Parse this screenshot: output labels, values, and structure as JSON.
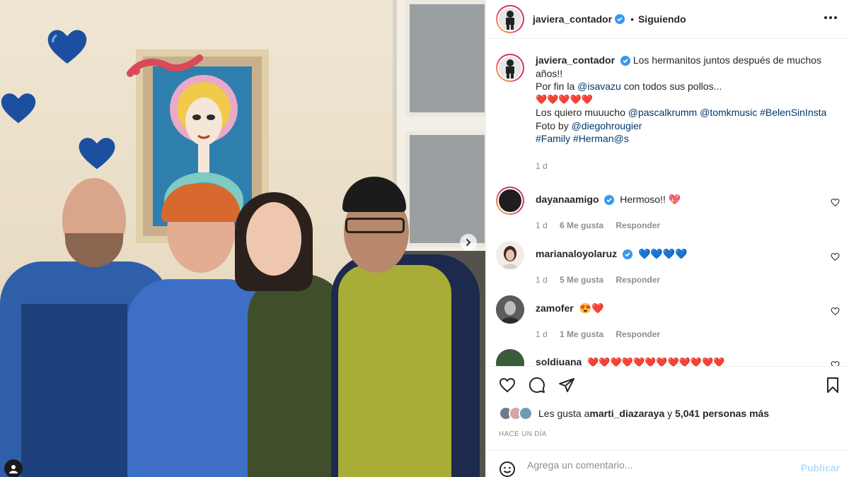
{
  "post": {
    "author": "javiera_contador",
    "follow_status": "Siguiendo",
    "separator": "•",
    "caption_lines": [
      "Los hermanitos juntos después de muchos",
      "años!!"
    ],
    "caption_line2_prefix": "Por fin la ",
    "caption_line2_mention": "@isavazu",
    "caption_line2_suffix": " con todos sus pollos...",
    "caption_hearts": "❤️❤️❤️❤️❤️",
    "caption_line4_prefix": "Los quiero muuucho ",
    "caption_line4_mention1": "@pascalkrumm",
    "caption_line4_mention2": "@tomkmusic",
    "caption_line4_hashtag": "#BelenSinInsta",
    "caption_line5_prefix": "Foto by ",
    "caption_line5_mention": "@diegohrougier",
    "caption_line6_hashtag1": "#Family",
    "caption_line6_hashtag2": "#Herman@s",
    "time_ago": "1 d"
  },
  "comments": [
    {
      "user": "dayanaamigo",
      "verified": true,
      "text": "Hermoso!! 💖",
      "age": "1 d",
      "likes": "6 Me gusta",
      "reply": "Responder"
    },
    {
      "user": "marianaloyolaruz",
      "verified": true,
      "text": "💙💙💙💙",
      "age": "1 d",
      "likes": "5 Me gusta",
      "reply": "Responder"
    },
    {
      "user": "zamofer",
      "verified": false,
      "text": "😍❤️",
      "age": "1 d",
      "likes": "1 Me gusta",
      "reply": "Responder"
    },
    {
      "user": "soldiuana",
      "verified": false,
      "text": "❤️❤️❤️❤️❤️❤️❤️❤️❤️❤️❤️❤️",
      "age": "",
      "likes": "",
      "reply": ""
    }
  ],
  "likes": {
    "prefix": "Les gusta a ",
    "user": "marti_diazaraya",
    "middle": " y ",
    "count": "5,041 personas más"
  },
  "posted_when": "HACE UN DÍA",
  "comment_box": {
    "placeholder": "Agrega un comentario...",
    "publish_label": "Publicar"
  },
  "icons": {
    "verified": "verified-badge-icon",
    "more": "more-options-icon",
    "like": "heart-icon",
    "comment": "comment-icon",
    "share": "share-icon",
    "save": "bookmark-icon",
    "emoji": "emoji-icon",
    "next": "chevron-right-icon",
    "tag": "user-tag-icon"
  },
  "colors": {
    "link": "#00376b",
    "verified": "#3897f0",
    "muted": "#8e8e8e",
    "publish_disabled": "#b2dffc"
  }
}
